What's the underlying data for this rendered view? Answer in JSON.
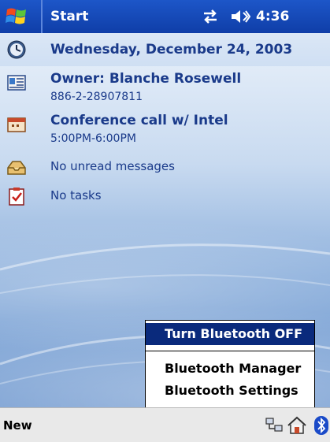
{
  "titlebar": {
    "title": "Start",
    "time": "4:36"
  },
  "today": {
    "date": "Wednesday, December 24, 2003",
    "owner_title": "Owner: Blanche Rosewell",
    "owner_phone": "886-2-28907811",
    "appointment_title": "Conference call w/ Intel",
    "appointment_time": "5:00PM-6:00PM",
    "messages": "No unread messages",
    "tasks": "No tasks"
  },
  "menu": {
    "items": [
      {
        "label": "Turn Bluetooth OFF",
        "selected": true
      },
      {
        "label": "Bluetooth Manager",
        "selected": false
      },
      {
        "label": "Bluetooth Settings",
        "selected": false
      }
    ]
  },
  "bottombar": {
    "new_label": "New"
  },
  "colors": {
    "titlebar": "#1d56c8",
    "text_blue": "#1a3a8a",
    "menu_selected": "#0a2a7c"
  },
  "icons": [
    "windows-flag-icon",
    "connectivity-icon",
    "volume-icon",
    "clock-icon",
    "owner-card-icon",
    "calendar-icon",
    "inbox-icon",
    "tasks-icon",
    "network-icon",
    "home-icon",
    "bluetooth-icon"
  ]
}
